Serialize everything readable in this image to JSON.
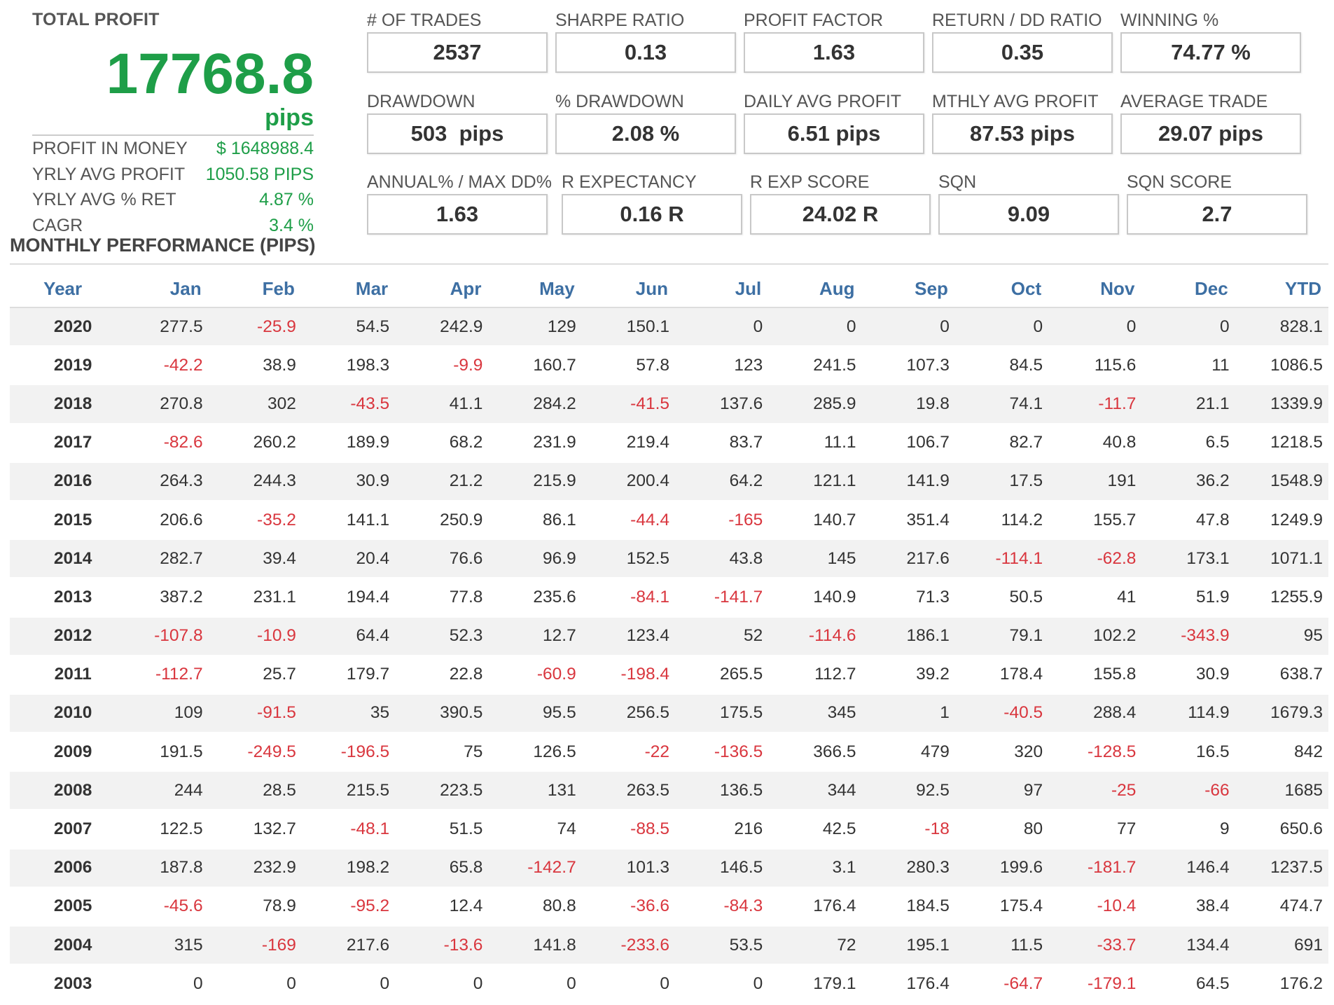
{
  "summary": {
    "total_profit_label": "TOTAL PROFIT",
    "total_profit_value": "17768.8",
    "total_profit_unit": "pips",
    "rows": [
      {
        "label": "PROFIT IN MONEY",
        "value": "$ 1648988.4"
      },
      {
        "label": "YRLY AVG PROFIT",
        "value": "1050.58 PIPS"
      },
      {
        "label": "YRLY AVG % RET",
        "value": "4.87 %"
      },
      {
        "label": "CAGR",
        "value": "3.4 %"
      }
    ]
  },
  "stats": [
    {
      "label": "# OF TRADES",
      "value": "2537"
    },
    {
      "label": "SHARPE RATIO",
      "value": "0.13"
    },
    {
      "label": "PROFIT FACTOR",
      "value": "1.63"
    },
    {
      "label": "RETURN / DD RATIO",
      "value": "0.35"
    },
    {
      "label": "WINNING %",
      "value": "74.77 %"
    },
    {
      "label": "DRAWDOWN",
      "value": "503  pips"
    },
    {
      "label": "% DRAWDOWN",
      "value": "2.08 %"
    },
    {
      "label": "DAILY AVG PROFIT",
      "value": "6.51 pips"
    },
    {
      "label": "MTHLY AVG PROFIT",
      "value": "87.53 pips"
    },
    {
      "label": "AVERAGE TRADE",
      "value": "29.07 pips"
    },
    {
      "label": "ANNUAL% / MAX DD%",
      "value": "1.63"
    },
    {
      "label": "R EXPECTANCY",
      "value": "0.16 R"
    },
    {
      "label": "R EXP SCORE",
      "value": "24.02 R"
    },
    {
      "label": "SQN",
      "value": "9.09"
    },
    {
      "label": "SQN SCORE",
      "value": "2.7"
    }
  ],
  "monthly": {
    "title": "MONTHLY PERFORMANCE (PIPS)",
    "headers": [
      "Year",
      "Jan",
      "Feb",
      "Mar",
      "Apr",
      "May",
      "Jun",
      "Jul",
      "Aug",
      "Sep",
      "Oct",
      "Nov",
      "Dec",
      "YTD"
    ],
    "rows": [
      [
        "2020",
        "277.5",
        "-25.9",
        "54.5",
        "242.9",
        "129",
        "150.1",
        "0",
        "0",
        "0",
        "0",
        "0",
        "0",
        "828.1"
      ],
      [
        "2019",
        "-42.2",
        "38.9",
        "198.3",
        "-9.9",
        "160.7",
        "57.8",
        "123",
        "241.5",
        "107.3",
        "84.5",
        "115.6",
        "11",
        "1086.5"
      ],
      [
        "2018",
        "270.8",
        "302",
        "-43.5",
        "41.1",
        "284.2",
        "-41.5",
        "137.6",
        "285.9",
        "19.8",
        "74.1",
        "-11.7",
        "21.1",
        "1339.9"
      ],
      [
        "2017",
        "-82.6",
        "260.2",
        "189.9",
        "68.2",
        "231.9",
        "219.4",
        "83.7",
        "11.1",
        "106.7",
        "82.7",
        "40.8",
        "6.5",
        "1218.5"
      ],
      [
        "2016",
        "264.3",
        "244.3",
        "30.9",
        "21.2",
        "215.9",
        "200.4",
        "64.2",
        "121.1",
        "141.9",
        "17.5",
        "191",
        "36.2",
        "1548.9"
      ],
      [
        "2015",
        "206.6",
        "-35.2",
        "141.1",
        "250.9",
        "86.1",
        "-44.4",
        "-165",
        "140.7",
        "351.4",
        "114.2",
        "155.7",
        "47.8",
        "1249.9"
      ],
      [
        "2014",
        "282.7",
        "39.4",
        "20.4",
        "76.6",
        "96.9",
        "152.5",
        "43.8",
        "145",
        "217.6",
        "-114.1",
        "-62.8",
        "173.1",
        "1071.1"
      ],
      [
        "2013",
        "387.2",
        "231.1",
        "194.4",
        "77.8",
        "235.6",
        "-84.1",
        "-141.7",
        "140.9",
        "71.3",
        "50.5",
        "41",
        "51.9",
        "1255.9"
      ],
      [
        "2012",
        "-107.8",
        "-10.9",
        "64.4",
        "52.3",
        "12.7",
        "123.4",
        "52",
        "-114.6",
        "186.1",
        "79.1",
        "102.2",
        "-343.9",
        "95"
      ],
      [
        "2011",
        "-112.7",
        "25.7",
        "179.7",
        "22.8",
        "-60.9",
        "-198.4",
        "265.5",
        "112.7",
        "39.2",
        "178.4",
        "155.8",
        "30.9",
        "638.7"
      ],
      [
        "2010",
        "109",
        "-91.5",
        "35",
        "390.5",
        "95.5",
        "256.5",
        "175.5",
        "345",
        "1",
        "-40.5",
        "288.4",
        "114.9",
        "1679.3"
      ],
      [
        "2009",
        "191.5",
        "-249.5",
        "-196.5",
        "75",
        "126.5",
        "-22",
        "-136.5",
        "366.5",
        "479",
        "320",
        "-128.5",
        "16.5",
        "842"
      ],
      [
        "2008",
        "244",
        "28.5",
        "215.5",
        "223.5",
        "131",
        "263.5",
        "136.5",
        "344",
        "92.5",
        "97",
        "-25",
        "-66",
        "1685"
      ],
      [
        "2007",
        "122.5",
        "132.7",
        "-48.1",
        "51.5",
        "74",
        "-88.5",
        "216",
        "42.5",
        "-18",
        "80",
        "77",
        "9",
        "650.6"
      ],
      [
        "2006",
        "187.8",
        "232.9",
        "198.2",
        "65.8",
        "-142.7",
        "101.3",
        "146.5",
        "3.1",
        "280.3",
        "199.6",
        "-181.7",
        "146.4",
        "1237.5"
      ],
      [
        "2005",
        "-45.6",
        "78.9",
        "-95.2",
        "12.4",
        "80.8",
        "-36.6",
        "-84.3",
        "176.4",
        "184.5",
        "175.4",
        "-10.4",
        "38.4",
        "474.7"
      ],
      [
        "2004",
        "315",
        "-169",
        "217.6",
        "-13.6",
        "141.8",
        "-233.6",
        "53.5",
        "72",
        "195.1",
        "11.5",
        "-33.7",
        "134.4",
        "691"
      ],
      [
        "2003",
        "0",
        "0",
        "0",
        "0",
        "0",
        "0",
        "0",
        "179.1",
        "176.4",
        "-64.7",
        "-179.1",
        "64.5",
        "176.2"
      ]
    ]
  },
  "colors": {
    "positive_green": "#1e9e48",
    "negative_red": "#d9363e",
    "header_blue": "#3d6fa3",
    "row_stripe": "#f2f2f2"
  }
}
